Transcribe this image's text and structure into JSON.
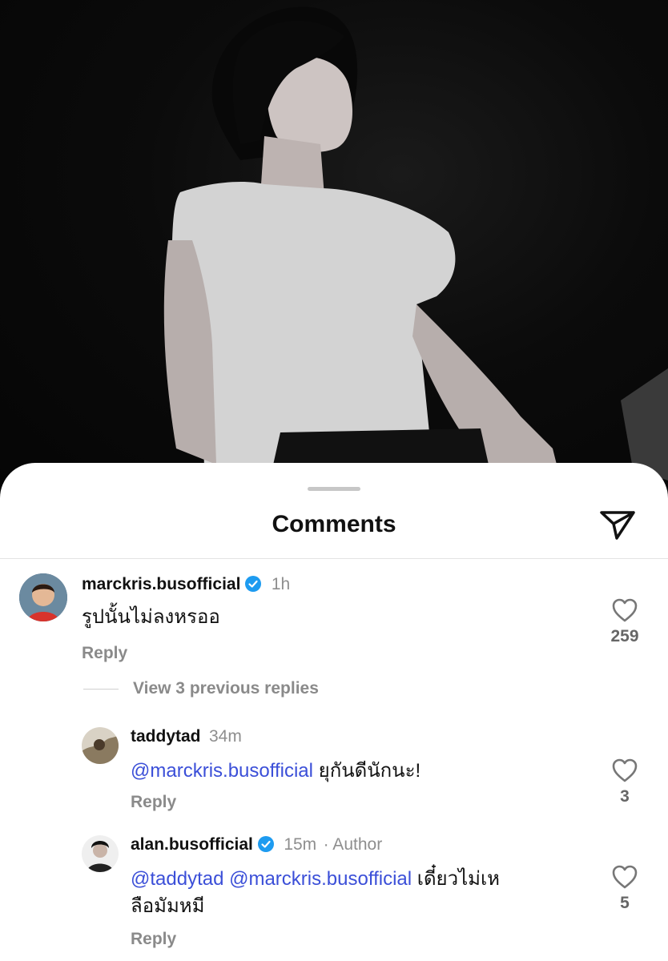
{
  "sheet": {
    "title": "Comments",
    "share_icon": "send-icon"
  },
  "comments": [
    {
      "username": "marckris.busofficial",
      "verified": true,
      "time": "1h",
      "text": "รูปนั้นไม่ลงหรออ",
      "reply_label": "Reply",
      "likes": "259"
    }
  ],
  "view_replies_label": "View 3 previous replies",
  "replies": [
    {
      "username": "taddytad",
      "verified": false,
      "time": "34m",
      "mentions": "@marckris.busofficial",
      "text": " ยุกันดีนักนะ!",
      "reply_label": "Reply",
      "likes": "3"
    },
    {
      "username": "alan.busofficial",
      "verified": true,
      "time": "15m",
      "author_tag": "· Author",
      "mentions": "@taddytad @marckris.busofficial",
      "text_line1": " เดี๋ยวไม่เห",
      "text_line2": "ลือมัมหมี",
      "reply_label": "Reply",
      "likes": "5"
    }
  ],
  "colors": {
    "mention": "#3b4fd8",
    "verified": "#1d9bf0"
  }
}
